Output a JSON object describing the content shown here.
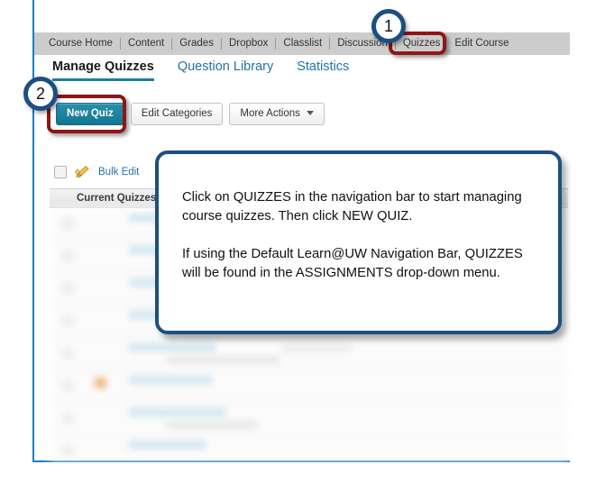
{
  "nav_bar": {
    "name": "course-navigation-bar",
    "items": [
      {
        "label": "Course Home"
      },
      {
        "label": "Content"
      },
      {
        "label": "Grades"
      },
      {
        "label": "Dropbox"
      },
      {
        "label": "Classlist"
      },
      {
        "label": "Discussion"
      },
      {
        "label": "Quizzes"
      },
      {
        "label": "Edit Course"
      }
    ]
  },
  "tabs": [
    {
      "label": "Manage Quizzes",
      "active": true
    },
    {
      "label": "Question Library",
      "active": false
    },
    {
      "label": "Statistics",
      "active": false
    }
  ],
  "toolbar": {
    "new_quiz_label": "New Quiz",
    "edit_categories_label": "Edit Categories",
    "more_actions_label": "More Actions"
  },
  "bulk_row": {
    "icon": "pencil-icon",
    "label": "Bulk Edit"
  },
  "list": {
    "column_header": "Current Quizzes"
  },
  "callout": {
    "text": "Click on QUIZZES in the navigation bar to start managing course quizzes. Then click NEW QUIZ.\n\nIf using the Default Learn@UW Navigation Bar, QUIZZES will be found in the ASSIGNMENTS drop-down menu.",
    "border_color": "#1b4f82"
  },
  "annotations": {
    "badge_1": "1",
    "badge_2": "2",
    "highlight_color": "#8e1616",
    "badge_ring_color": "#1b4f82"
  },
  "colors": {
    "navbar_bg": "#cccccc",
    "primary_button": "#12788f",
    "link_blue": "#2272a8",
    "frame_blue": "#1c7fc4"
  }
}
